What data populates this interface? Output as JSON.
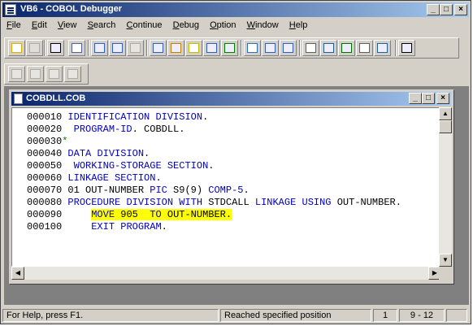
{
  "window": {
    "title": "VB6 - COBOL Debugger"
  },
  "menu": [
    {
      "label": "File",
      "hot": "F",
      "rest": "ile"
    },
    {
      "label": "Edit",
      "hot": "E",
      "rest": "dit"
    },
    {
      "label": "View",
      "hot": "V",
      "rest": "iew"
    },
    {
      "label": "Search",
      "hot": "S",
      "rest": "earch"
    },
    {
      "label": "Continue",
      "hot": "C",
      "rest": "ontinue"
    },
    {
      "label": "Debug",
      "hot": "D",
      "rest": "ebug"
    },
    {
      "label": "Option",
      "hot": "O",
      "rest": "ption"
    },
    {
      "label": "Window",
      "hot": "W",
      "rest": "indow"
    },
    {
      "label": "Help",
      "hot": "H",
      "rest": "elp"
    }
  ],
  "toolbar_icons": [
    "open-folder-icon",
    "copy-icon",
    "hand-icon",
    "watch-icon",
    "step-into-icon",
    "step-over-icon",
    "step-out-icon",
    "breakpoint-list-icon",
    "toggle-breakpoint-icon",
    "clear-breakpoint-icon",
    "copy-variable-icon",
    "paste-variable-icon",
    "find-icon",
    "find-variable-icon",
    "replace-variable-icon",
    "animate-icon",
    "call-stack-icon",
    "register-icon",
    "memory-icon",
    "output-icon",
    "context-help-icon"
  ],
  "toolbar2_icons": [
    "go-icon",
    "break-icon",
    "trace-icon",
    "reset-icon"
  ],
  "child": {
    "title": "COBDLL.COB",
    "lines": [
      {
        "num": "000010",
        "text": " IDENTIFICATION DIVISION."
      },
      {
        "num": "000020",
        "text": "  PROGRAM-ID. COBDLL."
      },
      {
        "num": "000030",
        "text": "*"
      },
      {
        "num": "000040",
        "text": " DATA DIVISION."
      },
      {
        "num": "000050",
        "text": "  WORKING-STORAGE SECTION."
      },
      {
        "num": "000060",
        "text": " LINKAGE SECTION."
      },
      {
        "num": "000070",
        "text": " 01 OUT-NUMBER PIC S9(9) COMP-5."
      },
      {
        "num": "000080",
        "text": " PROCEDURE DIVISION WITH STDCALL LINKAGE USING OUT-NUMBER."
      },
      {
        "num": "000090",
        "text": "     MOVE 905  TO OUT-NUMBER."
      },
      {
        "num": "000100",
        "text": "     EXIT PROGRAM."
      }
    ]
  },
  "status": {
    "help": "For Help, press F1.",
    "message": "Reached specified position",
    "line": "1",
    "position": "9 - 12"
  }
}
